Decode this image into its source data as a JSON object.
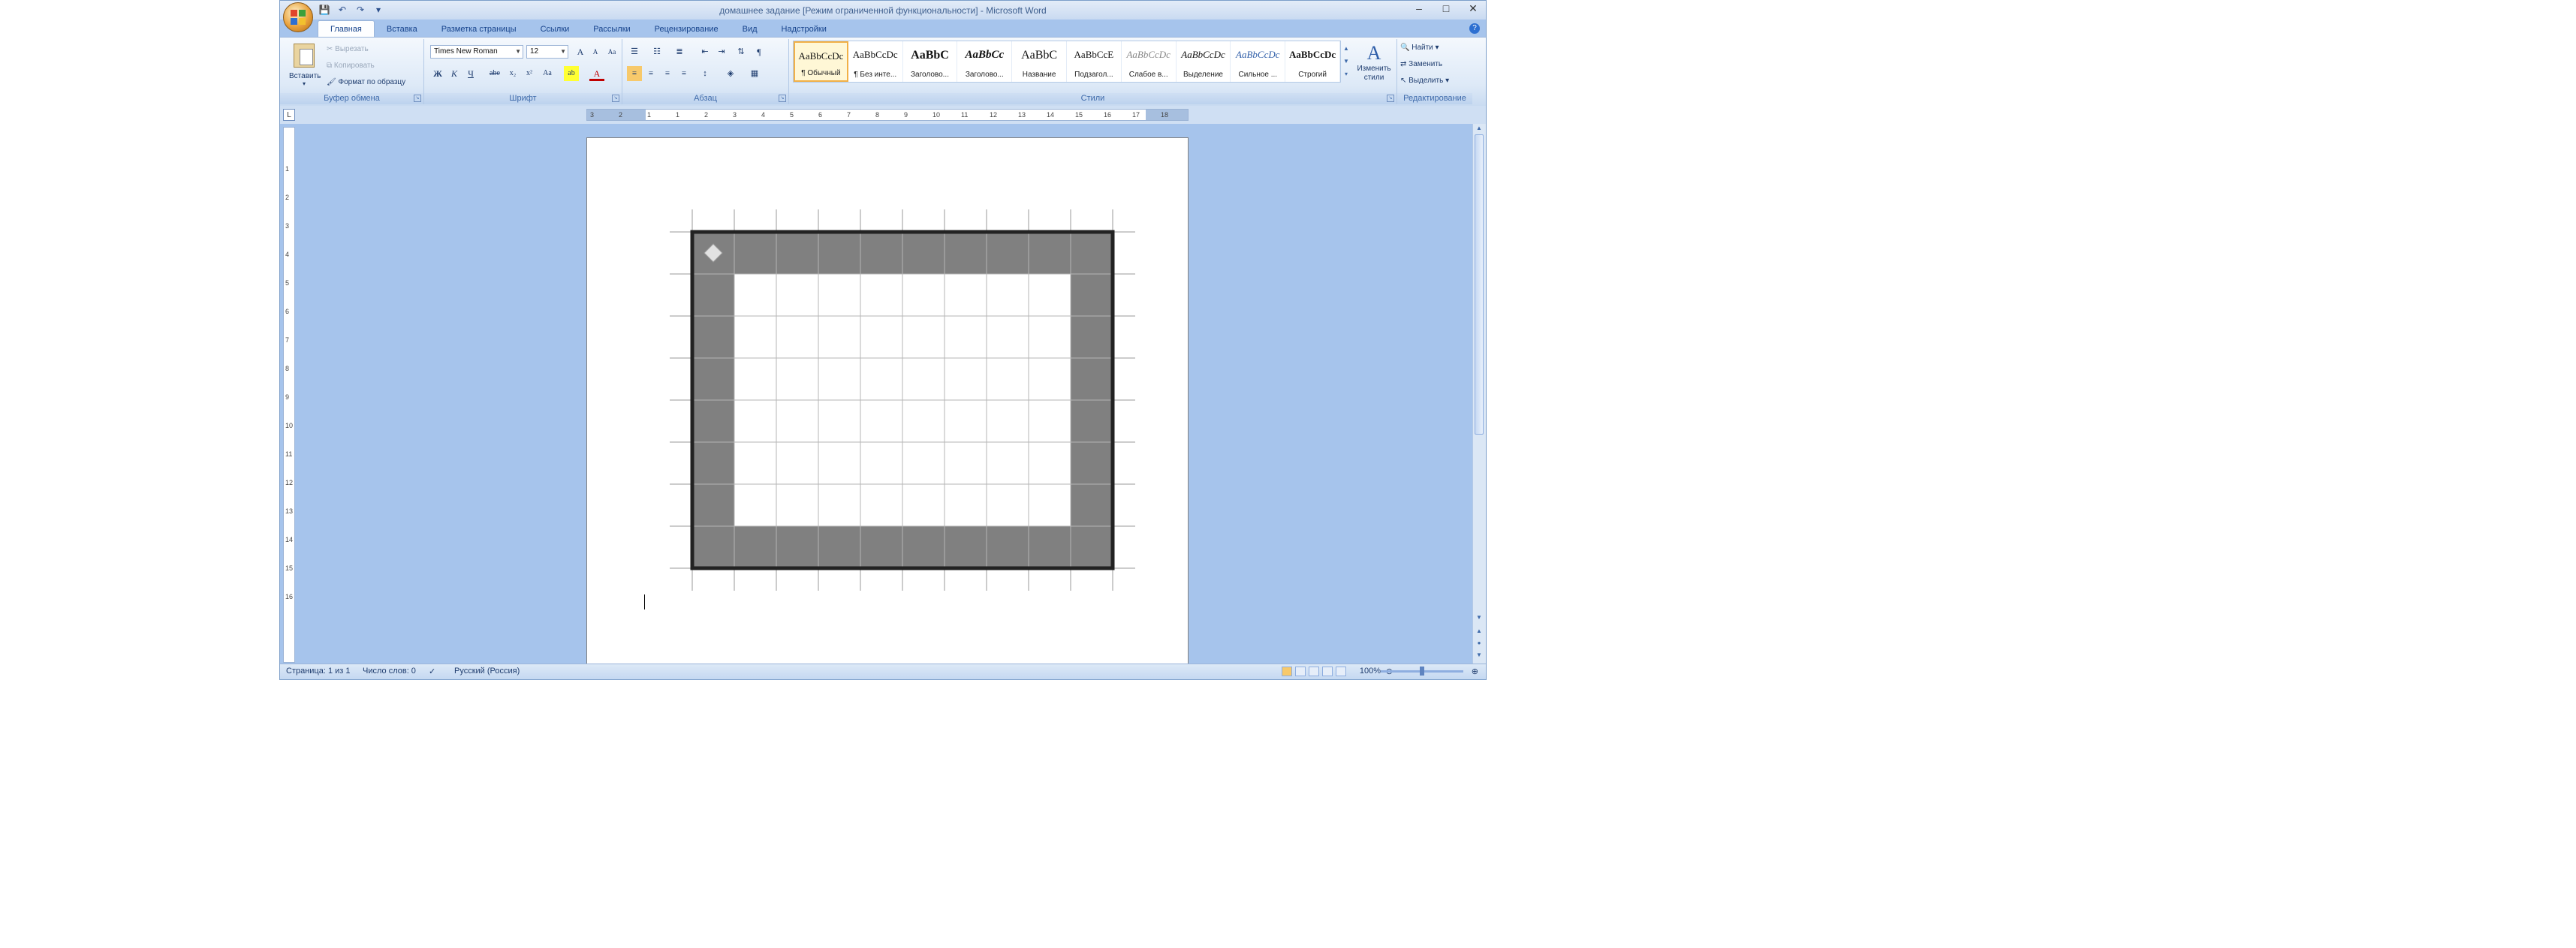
{
  "window": {
    "title": "домашнее задание [Режим ограниченной функциональности] - Microsoft Word"
  },
  "qat": {
    "save": "💾",
    "undo": "↶",
    "redo": "↷",
    "more": "▾"
  },
  "window_controls": {
    "minimize": "–",
    "maximize": "□",
    "close": "✕"
  },
  "tabs": [
    "Главная",
    "Вставка",
    "Разметка страницы",
    "Ссылки",
    "Рассылки",
    "Рецензирование",
    "Вид",
    "Надстройки"
  ],
  "clipboard": {
    "paste": "Вставить",
    "cut": "Вырезать",
    "copy": "Копировать",
    "format_painter": "Формат по образцу",
    "label": "Буфер обмена"
  },
  "font": {
    "name": "Times New Roman",
    "size": "12",
    "label": "Шрифт",
    "grow": "A",
    "shrink": "A",
    "clear": "Aa",
    "bold": "Ж",
    "italic": "К",
    "underline": "Ч",
    "strike": "abe",
    "subscript": "x₂",
    "superscript": "x²",
    "case": "Aa",
    "highlight": "ab",
    "color": "A"
  },
  "paragraph": {
    "label": "Абзац"
  },
  "styles": {
    "label": "Стили",
    "items": [
      {
        "sample": "AaBbCcDc",
        "name": "¶ Обычный"
      },
      {
        "sample": "AaBbCcDc",
        "name": "¶ Без инте..."
      },
      {
        "sample": "AaBbC",
        "name": "Заголово..."
      },
      {
        "sample": "AaBbCc",
        "name": "Заголово..."
      },
      {
        "sample": "AaBbC",
        "name": "Название"
      },
      {
        "sample": "AaBbCcE",
        "name": "Подзагол..."
      },
      {
        "sample": "AaBbCcDc",
        "name": "Слабое в..."
      },
      {
        "sample": "AaBbCcDc",
        "name": "Выделение"
      },
      {
        "sample": "AaBbCcDc",
        "name": "Сильное ..."
      },
      {
        "sample": "AaBbCcDc",
        "name": "Строгий"
      }
    ],
    "change_styles": "Изменить стили"
  },
  "editing": {
    "label": "Редактирование",
    "find": "Найти",
    "replace": "Заменить",
    "select": "Выделить"
  },
  "ruler": {
    "h_ticks": [
      "3",
      "2",
      "1",
      "1",
      "2",
      "3",
      "4",
      "5",
      "6",
      "7",
      "8",
      "9",
      "10",
      "11",
      "12",
      "13",
      "14",
      "15",
      "16",
      "17",
      "18"
    ],
    "v_ticks": [
      "1",
      "2",
      "3",
      "4",
      "5",
      "6",
      "7",
      "8",
      "9",
      "10",
      "11",
      "12",
      "13",
      "14",
      "15",
      "16"
    ]
  },
  "table": {
    "rows": 8,
    "cols": 10,
    "border_color": "#222222",
    "shaded_color": "#808080"
  },
  "status": {
    "page": "Страница: 1 из 1",
    "words": "Число слов: 0",
    "language": "Русский (Россия)",
    "zoom": "100%"
  }
}
